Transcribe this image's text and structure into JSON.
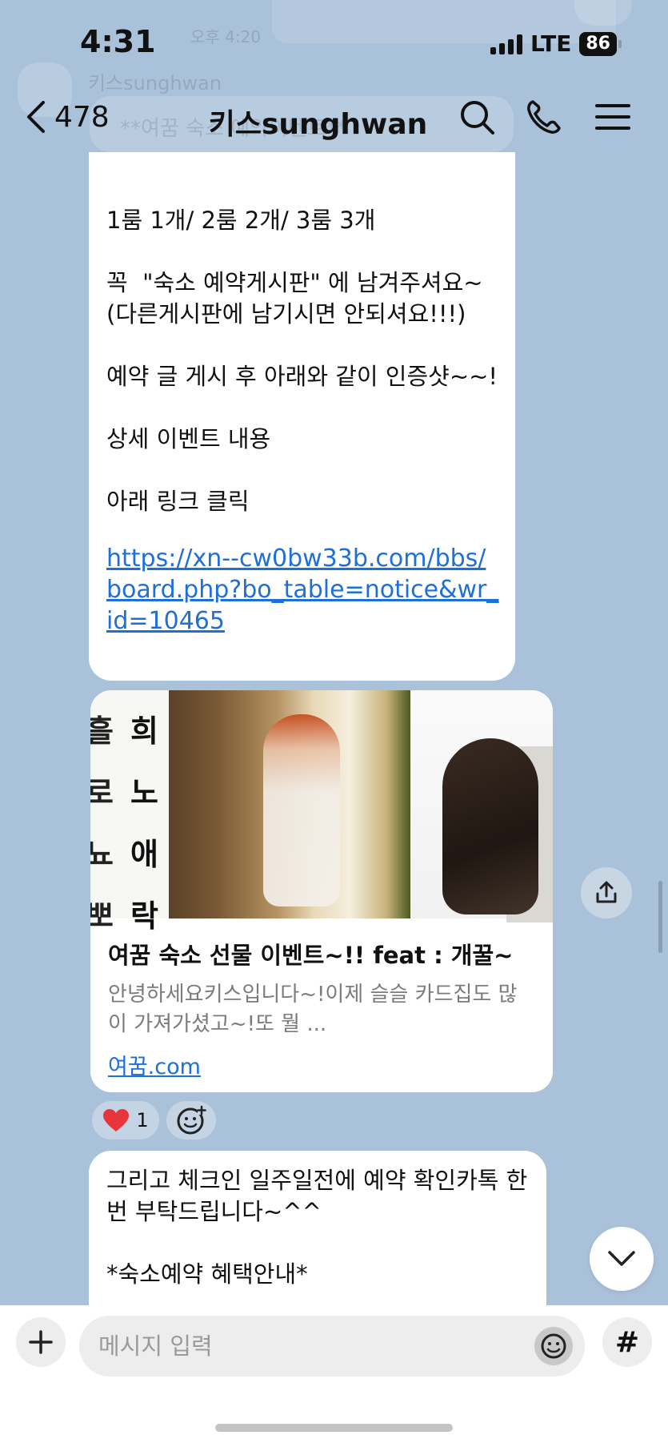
{
  "status_bar": {
    "time": "4:31",
    "network": "LTE",
    "battery": "86"
  },
  "background_faded": {
    "time": "오후 4:20",
    "sender": "키스sunghwan",
    "preview": "**여꿈 숙소 예약이벤트**"
  },
  "header": {
    "back_count": "478",
    "title": "키스sunghwan",
    "icons": [
      "back-chevron-icon",
      "search-icon",
      "phone-icon",
      "menu-icon"
    ]
  },
  "messages": {
    "msg1": {
      "text": "1룸 1개/ 2룸 2개/ 3룸 3개\n\n꼭  \"숙소 예약게시판\" 에 남겨주셔요~\n(다른게시판에 남기시면 안되셔요!!!)\n\n예약 글 게시 후 아래와 같이 인증샷~~!\n\n상세 이벤트 내용\n\n아래 링크 클릭",
      "link": "https://xn--cw0bw33b.com/bbs/board.php?bo_table=notice&wr_id=10465"
    },
    "card": {
      "title": "여꿈 숙소 선물 이벤트~!! feat : 개꿀~",
      "description": "안녕하세요키스입니다~!이제 슬슬 카드집도 많이 가져가셨고~!또 뭘 ...",
      "domain": "여꿈.com",
      "calligraphy_left": [
        "흘",
        "로",
        "뇨",
        "뽀"
      ],
      "calligraphy_right": [
        "희",
        "노",
        "애",
        "락"
      ]
    },
    "reaction": {
      "heart_count": "1",
      "heart_color": "#e8353b"
    },
    "msg2": {
      "text": "그리고 체크인 일주일전에 예약 확인카톡 한번 부탁드립니다~^^\n\n*숙소예약 혜택안내*"
    }
  },
  "input": {
    "placeholder": "메시지 입력",
    "hash": "#"
  },
  "colors": {
    "chat_background": "#a9c1d9",
    "link": "#1e6fd9",
    "bubble": "#ffffff"
  }
}
